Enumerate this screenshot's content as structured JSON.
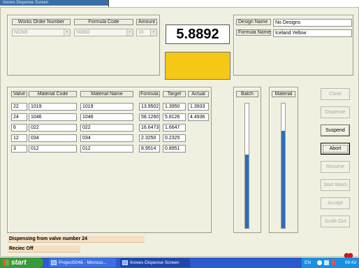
{
  "window": {
    "title": "Inoves Dispense Screen"
  },
  "order": {
    "works_order_header": "Works Order Number",
    "formula_code_header": "Formula Code",
    "amount_header": "Amount",
    "works_order_value": "NONE",
    "formula_code_value": "50060",
    "amount_value": "10"
  },
  "design": {
    "design_name_label": "Design Name",
    "design_name_value": "No Designs",
    "formula_name_label": "Formula Name",
    "formula_name_value": "Iceland Yellow"
  },
  "readout": {
    "value": "5.8892",
    "swatch_color": "#f5c816"
  },
  "table": {
    "headers": {
      "valve": "Valve",
      "material_code": "Material Code",
      "material_name": "Material Name",
      "formula": "Formula",
      "target": "Target",
      "actual": "Actual"
    },
    "rows": [
      {
        "valve": "22",
        "material_code": "1019",
        "material_name": "1019",
        "formula": "13.9502",
        "target": "1.3950",
        "actual": "1.3933"
      },
      {
        "valve": "24",
        "material_code": "1046",
        "material_name": "1046",
        "formula": "58.1260",
        "target": "5.8126",
        "actual": "4.4936"
      },
      {
        "valve": "6",
        "material_code": "022",
        "material_name": "022",
        "formula": "16.6473",
        "target": "1.6647",
        "actual": ""
      },
      {
        "valve": "12",
        "material_code": "034",
        "material_name": "034",
        "formula": "2.3250",
        "target": "0.2325",
        "actual": ""
      },
      {
        "valve": "3",
        "material_code": "012",
        "material_name": "012",
        "formula": "8.9514",
        "target": "0.8951",
        "actual": ""
      }
    ]
  },
  "gauges": {
    "batch_label": "Batch",
    "batch_level": 0.59,
    "material_label": "Material",
    "material_level": 0.78,
    "fill_color": "#2c6dbb"
  },
  "buttons": {
    "close": "Close",
    "dispense": "Dispense",
    "suspend": "Suspend",
    "abort": "Abort",
    "resume": "Resume",
    "start_wash": "Start Wash",
    "accept": "Accept",
    "scale_out": "Scale Out"
  },
  "status": {
    "dispensing": "Dispensing from valve number 24",
    "recirc": "Reciec Off"
  },
  "taskbar": {
    "start": "start",
    "task1": "Project5048 - Microso...",
    "task2": "Inoves Dispense Screen",
    "language": "EN",
    "clock": "09:43"
  }
}
